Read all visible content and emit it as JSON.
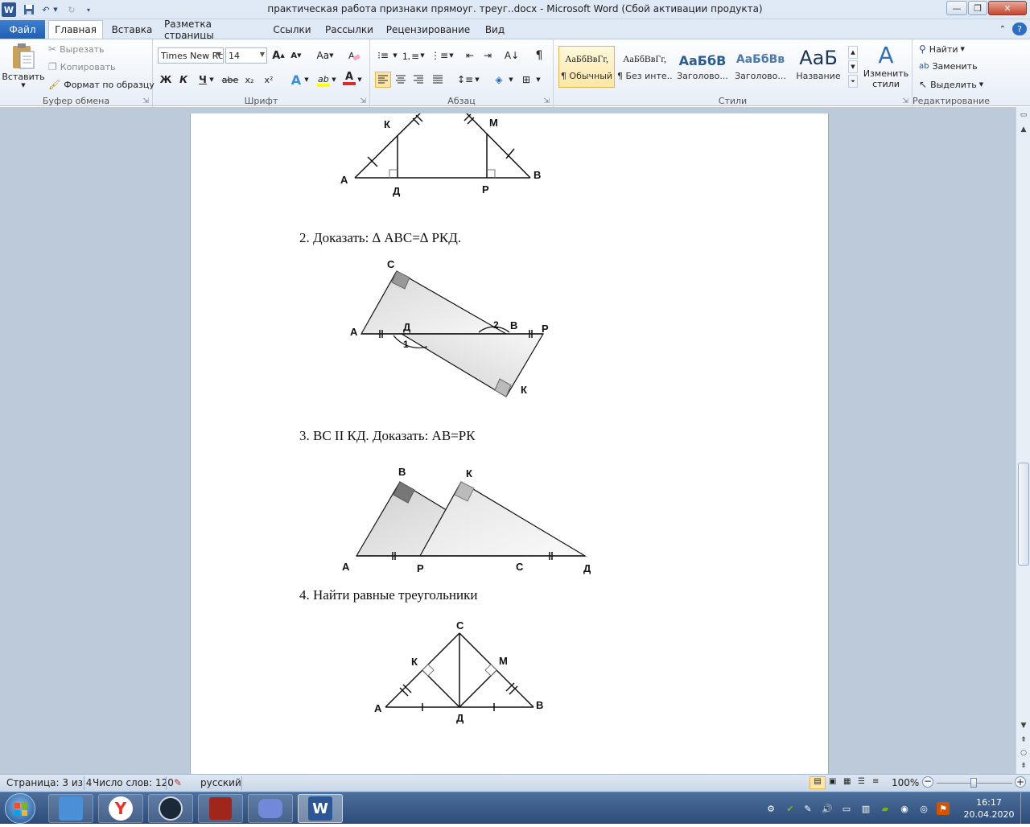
{
  "window": {
    "title": "практическая работа признаки прямоуг. треуг..docx - Microsoft Word (Сбой активации продукта)"
  },
  "tabs": {
    "file": "Файл",
    "items": [
      "Главная",
      "Вставка",
      "Разметка страницы",
      "Ссылки",
      "Рассылки",
      "Рецензирование",
      "Вид"
    ],
    "active": "Главная"
  },
  "ribbon": {
    "clipboard": {
      "label": "Буфер обмена",
      "paste": "Вставить",
      "cut": "Вырезать",
      "copy": "Копировать",
      "format_painter": "Формат по образцу"
    },
    "font": {
      "label": "Шрифт",
      "name": "Times New Rc",
      "size": "14",
      "bold": "Ж",
      "italic": "К",
      "underline": "Ч",
      "strike": "abe",
      "subscript": "x₂",
      "superscript": "x²",
      "grow": "A",
      "shrink": "A",
      "case": "Aa",
      "color_letter": "A"
    },
    "paragraph": {
      "label": "Абзац",
      "pilcrow": "¶"
    },
    "styles": {
      "label": "Стили",
      "items": [
        {
          "sample": "АаБбВвГг,",
          "name": "¶ Обычный"
        },
        {
          "sample": "АаБбВвГг,",
          "name": "¶ Без инте..."
        },
        {
          "sample": "АаБбВ",
          "name": "Заголово..."
        },
        {
          "sample": "АаБбВв",
          "name": "Заголово..."
        },
        {
          "sample": "АаБ",
          "name": "Название"
        }
      ],
      "change_styles": "Изменить стили"
    },
    "editing": {
      "label": "Редактирование",
      "find": "Найти",
      "replace": "Заменить",
      "select": "Выделить"
    }
  },
  "document": {
    "task2": "2.  Доказать: ∆ АВС=∆ РКД.",
    "task3": "3.  ВС II КД. Доказать: АВ=РК",
    "task4": "4.  Найти равные треугольники",
    "fig1_labels": {
      "A": "А",
      "D": "Д",
      "P": "Р",
      "B": "В",
      "K": "К",
      "M": "М"
    },
    "fig2_labels": {
      "C": "С",
      "A": "А",
      "D": "Д",
      "B": "В",
      "P": "Р",
      "K": "К",
      "n1": "1",
      "n2": "2"
    },
    "fig3_labels": {
      "B": "В",
      "K": "К",
      "A": "А",
      "P": "Р",
      "C": "С",
      "D": "Д"
    },
    "fig4_labels": {
      "C": "С",
      "K": "К",
      "M": "М",
      "A": "А",
      "D": "Д",
      "B": "В"
    }
  },
  "statusbar": {
    "page": "Страница: 3 из 4",
    "words": "Число слов: 120",
    "language": "русский",
    "zoom": "100%"
  },
  "taskbar": {
    "clock_time": "16:17",
    "clock_date": "20.04.2020"
  },
  "colors": {
    "accent": "#2b5797",
    "file_tab": "#2c6bc2",
    "doc_background": "#bccada"
  }
}
